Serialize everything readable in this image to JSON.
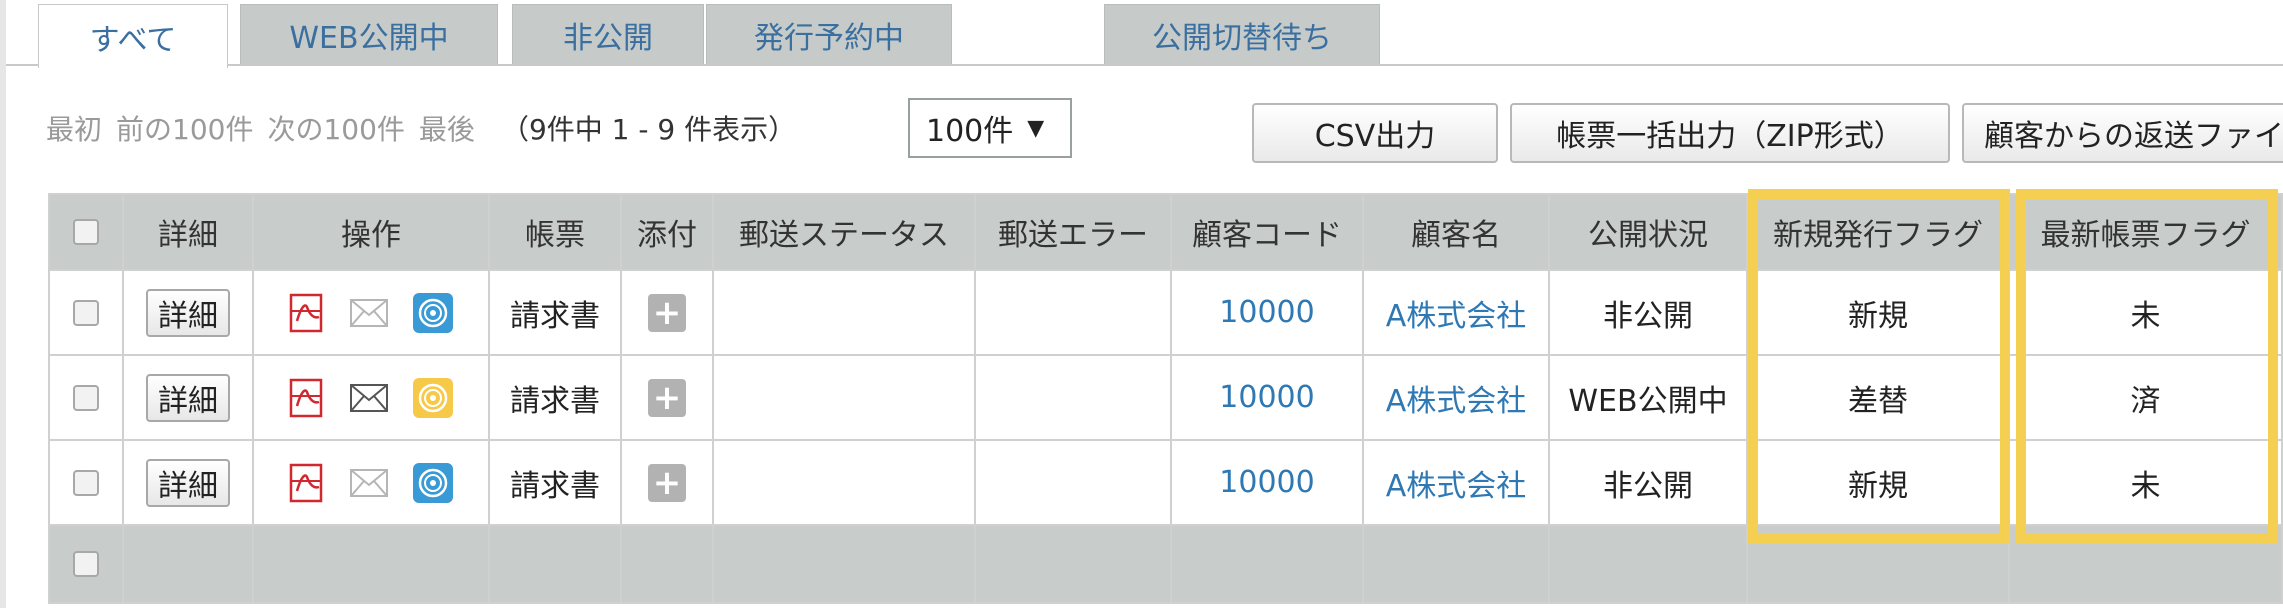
{
  "tabs": [
    {
      "label": "すべて",
      "active": true
    },
    {
      "label": "WEB公開中",
      "active": false
    },
    {
      "label": "非公開",
      "active": false
    },
    {
      "label": "発行予約中",
      "active": false
    },
    {
      "label": "公開切替待ち",
      "active": false
    }
  ],
  "pager": {
    "first": "最初",
    "prev": "前の100件",
    "next": "次の100件",
    "last": "最後",
    "count": "（9件中 1 - 9 件表示）",
    "page_size": "100件"
  },
  "toolbar": {
    "csv_label": "CSV出力",
    "zip_label": "帳票一括出力（ZIP形式）",
    "return_label": "顧客からの返送ファイル"
  },
  "table": {
    "headers": [
      "詳細",
      "操作",
      "帳票",
      "添付",
      "郵送ステータス",
      "郵送エラー",
      "顧客コード",
      "顧客名",
      "公開状況",
      "新規発行フラグ",
      "最新帳票フラグ"
    ],
    "detail_label": "詳細",
    "rows": [
      {
        "doc": "請求書",
        "postal_status": "",
        "postal_error": "",
        "customer_code": "10000",
        "customer_name": "A株式会社",
        "publish_status": "非公開",
        "new_flag": "新規",
        "latest_flag": "未",
        "mail_active": false,
        "web_icon": "web-blue-icon"
      },
      {
        "doc": "請求書",
        "postal_status": "",
        "postal_error": "",
        "customer_code": "10000",
        "customer_name": "A株式会社",
        "publish_status": "WEB公開中",
        "new_flag": "差替",
        "latest_flag": "済",
        "mail_active": true,
        "web_icon": "web-yellow-icon"
      },
      {
        "doc": "請求書",
        "postal_status": "",
        "postal_error": "",
        "customer_code": "10000",
        "customer_name": "A株式会社",
        "publish_status": "非公開",
        "new_flag": "新規",
        "latest_flag": "未",
        "mail_active": false,
        "web_icon": "web-blue-icon"
      }
    ]
  },
  "colors": {
    "link": "#2e78b4",
    "highlight": "#f4cf52",
    "header_bg": "#c8cccb",
    "pdf_red": "#d0282e",
    "web_blue": "#3a9ad6",
    "web_yellow": "#f7c948"
  }
}
